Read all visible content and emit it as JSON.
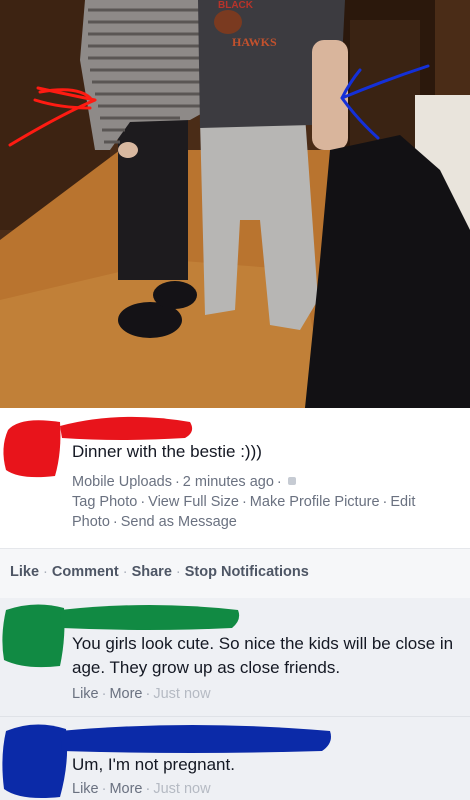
{
  "photo": {
    "shirt_print": "HAWKS",
    "shirt_print_top": "BLACK"
  },
  "post": {
    "text": "Dinner with the bestie :)))",
    "album": "Mobile Uploads",
    "time": "2 minutes ago",
    "links": [
      "Tag Photo",
      "View Full Size",
      "Make Profile Picture",
      "Edit Photo",
      "Send as Message"
    ]
  },
  "actions": {
    "like": "Like",
    "comment": "Comment",
    "share": "Share",
    "stop_notifications": "Stop Notifications"
  },
  "comments": [
    {
      "text": "You girls look cute. So nice the kids will be close in age. They grow up as close friends.",
      "like": "Like",
      "more": "More",
      "time": "Just now"
    },
    {
      "text": "Um, I'm not pregnant.",
      "like": "Like",
      "more": "More",
      "time": "Just now"
    }
  ],
  "colors": {
    "redact_red": "#e8141b",
    "redact_green": "#118a43",
    "redact_blue": "#0b2aa8",
    "arrow_red": "#ff1b12",
    "arrow_blue": "#1430d8"
  }
}
